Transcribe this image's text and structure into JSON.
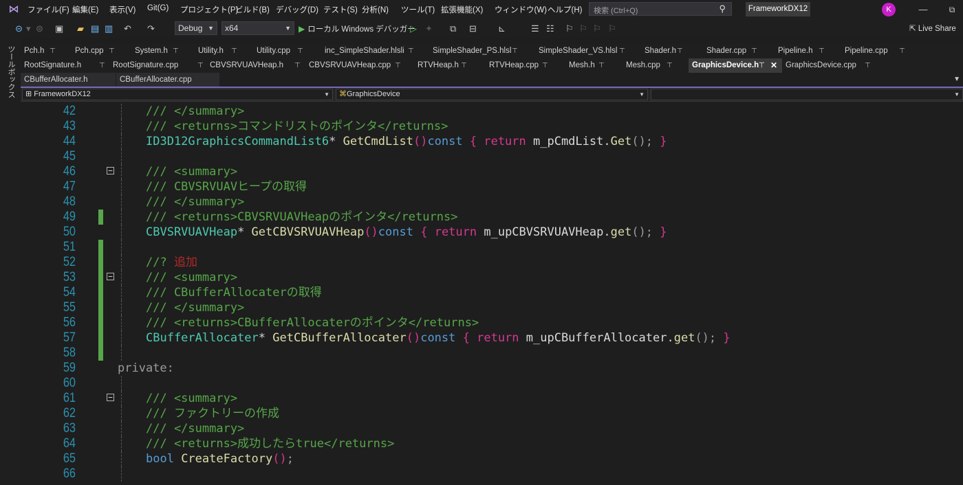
{
  "menu": [
    "ファイル(F)",
    "編集(E)",
    "表示(V)",
    "Git(G)",
    "プロジェクト(P)",
    "ビルド(B)",
    "デバッグ(D)",
    "テスト(S)",
    "分析(N)",
    "ツール(T)",
    "拡張機能(X)",
    "ウィンドウ(W)",
    "ヘルプ(H)"
  ],
  "search": {
    "placeholder": "検索 (Ctrl+Q)"
  },
  "solution_name": "FrameworkDX12",
  "avatar_initial": "K",
  "window": {
    "minimize": "—",
    "maximize": "⧉"
  },
  "toolbar": {
    "config": "Debug",
    "platform": "x64",
    "run_label": "ローカル Windows デバッガー",
    "live_share": "Live Share"
  },
  "toolbox_label": "ツールボックス",
  "tabs_row1": [
    "Pch.h",
    "Pch.cpp",
    "System.h",
    "Utility.h",
    "Utility.cpp",
    "inc_SimpleShader.hlsli",
    "SimpleShader_PS.hlsl",
    "SimpleShader_VS.hlsl",
    "Shader.h",
    "Shader.cpp",
    "Pipeline.h",
    "Pipeline.cpp"
  ],
  "tabs_row2": [
    "RootSignature.h",
    "RootSignature.cpp",
    "CBVSRVUAVHeap.h",
    "CBVSRVUAVHeap.cpp",
    "RTVHeap.h",
    "RTVHeap.cpp",
    "Mesh.h",
    "Mesh.cpp",
    "GraphicsDevice.h",
    "GraphicsDevice.cpp"
  ],
  "tabs_row3": [
    "CBufferAllocater.h",
    "CBufferAllocater.cpp"
  ],
  "active_tab": "GraphicsDevice.h",
  "nav": {
    "project": "FrameworkDX12",
    "scope": "GraphicsDevice"
  },
  "code": {
    "l42": {
      "num": "42",
      "t": "/// </summary>"
    },
    "l43": {
      "num": "43",
      "t": "/// <returns>コマンドリストのポインタ</returns>"
    },
    "l44": {
      "num": "44",
      "type": "ID3D12GraphicsCommandList6",
      "ptr": "* ",
      "fn": "GetCmdList",
      "paren": "()",
      "kw": "const",
      "ob": " { ",
      "ret": "return",
      "var": " m_pCmdList",
      "dot": ".",
      "m": "Get",
      "call": "();",
      "cb": " }"
    },
    "l45": {
      "num": "45"
    },
    "l46": {
      "num": "46",
      "t": "/// <summary>"
    },
    "l47": {
      "num": "47",
      "t": "/// CBVSRVUAVヒープの取得"
    },
    "l48": {
      "num": "48",
      "t": "/// </summary>"
    },
    "l49": {
      "num": "49",
      "t": "/// <returns>CBVSRVUAVHeapのポインタ</returns>"
    },
    "l50": {
      "num": "50",
      "type": "CBVSRVUAVHeap",
      "ptr": "* ",
      "fn": "GetCBVSRVUAVHeap",
      "paren": "()",
      "kw": "const",
      "ob": " { ",
      "ret": "return",
      "var": " m_upCBVSRVUAVHeap",
      "dot": ".",
      "m": "get",
      "call": "();",
      "cb": " }"
    },
    "l51": {
      "num": "51"
    },
    "l52": {
      "num": "52",
      "t": "//? ",
      "red": "追加"
    },
    "l53": {
      "num": "53",
      "t": "/// <summary>"
    },
    "l54": {
      "num": "54",
      "t": "/// CBufferAllocaterの取得"
    },
    "l55": {
      "num": "55",
      "t": "/// </summary>"
    },
    "l56": {
      "num": "56",
      "t": "/// <returns>CBufferAllocaterのポインタ</returns>"
    },
    "l57": {
      "num": "57",
      "type": "CBufferAllocater",
      "ptr": "* ",
      "fn": "GetCBufferAllocater",
      "paren": "()",
      "kw": "const",
      "ob": " { ",
      "ret": "return",
      "var": " m_upCBufferAllocater",
      "dot": ".",
      "m": "get",
      "call": "();",
      "cb": " }"
    },
    "l58": {
      "num": "58"
    },
    "l59": {
      "num": "59",
      "t": "private:"
    },
    "l60": {
      "num": "60"
    },
    "l61": {
      "num": "61",
      "t": "/// <summary>"
    },
    "l62": {
      "num": "62",
      "t": "/// ファクトリーの作成"
    },
    "l63": {
      "num": "63",
      "t": "/// </summary>"
    },
    "l64": {
      "num": "64",
      "t": "/// <returns>成功したらtrue</returns>"
    },
    "l65": {
      "num": "65",
      "kw": "bool",
      "fn": " CreateFactory",
      "paren": "()",
      "semi": ";"
    },
    "l66": {
      "num": "66"
    }
  },
  "colors": {
    "comment": "#57a64a",
    "keyword": "#569cd6",
    "type": "#4ec9b0",
    "function": "#dcdcaa",
    "line_number": "#2b91af",
    "changed_marker": "#57a64a"
  }
}
